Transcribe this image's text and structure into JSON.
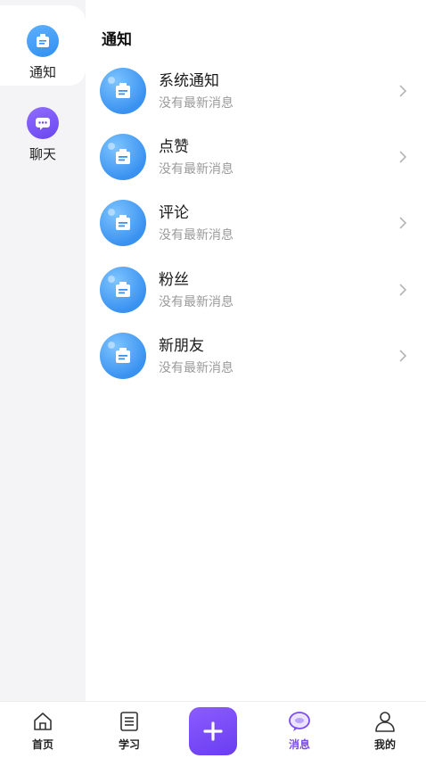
{
  "sidebar": {
    "items": [
      {
        "label": "通知",
        "icon": "notice-board-icon",
        "active": true
      },
      {
        "label": "聊天",
        "icon": "chat-bubble-icon",
        "active": false
      }
    ]
  },
  "main": {
    "title": "通知",
    "rows": [
      {
        "title": "系统通知",
        "subtitle": "没有最新消息"
      },
      {
        "title": "点赞",
        "subtitle": "没有最新消息"
      },
      {
        "title": "评论",
        "subtitle": "没有最新消息"
      },
      {
        "title": "粉丝",
        "subtitle": "没有最新消息"
      },
      {
        "title": "新朋友",
        "subtitle": "没有最新消息"
      }
    ]
  },
  "tabbar": {
    "home": "首页",
    "study": "学习",
    "add": "+",
    "messages": "消息",
    "mine": "我的"
  },
  "colors": {
    "accent": "#7a4cf2",
    "blue_icon": "#3a92f0",
    "sidebar_bg": "#f4f4f6"
  }
}
